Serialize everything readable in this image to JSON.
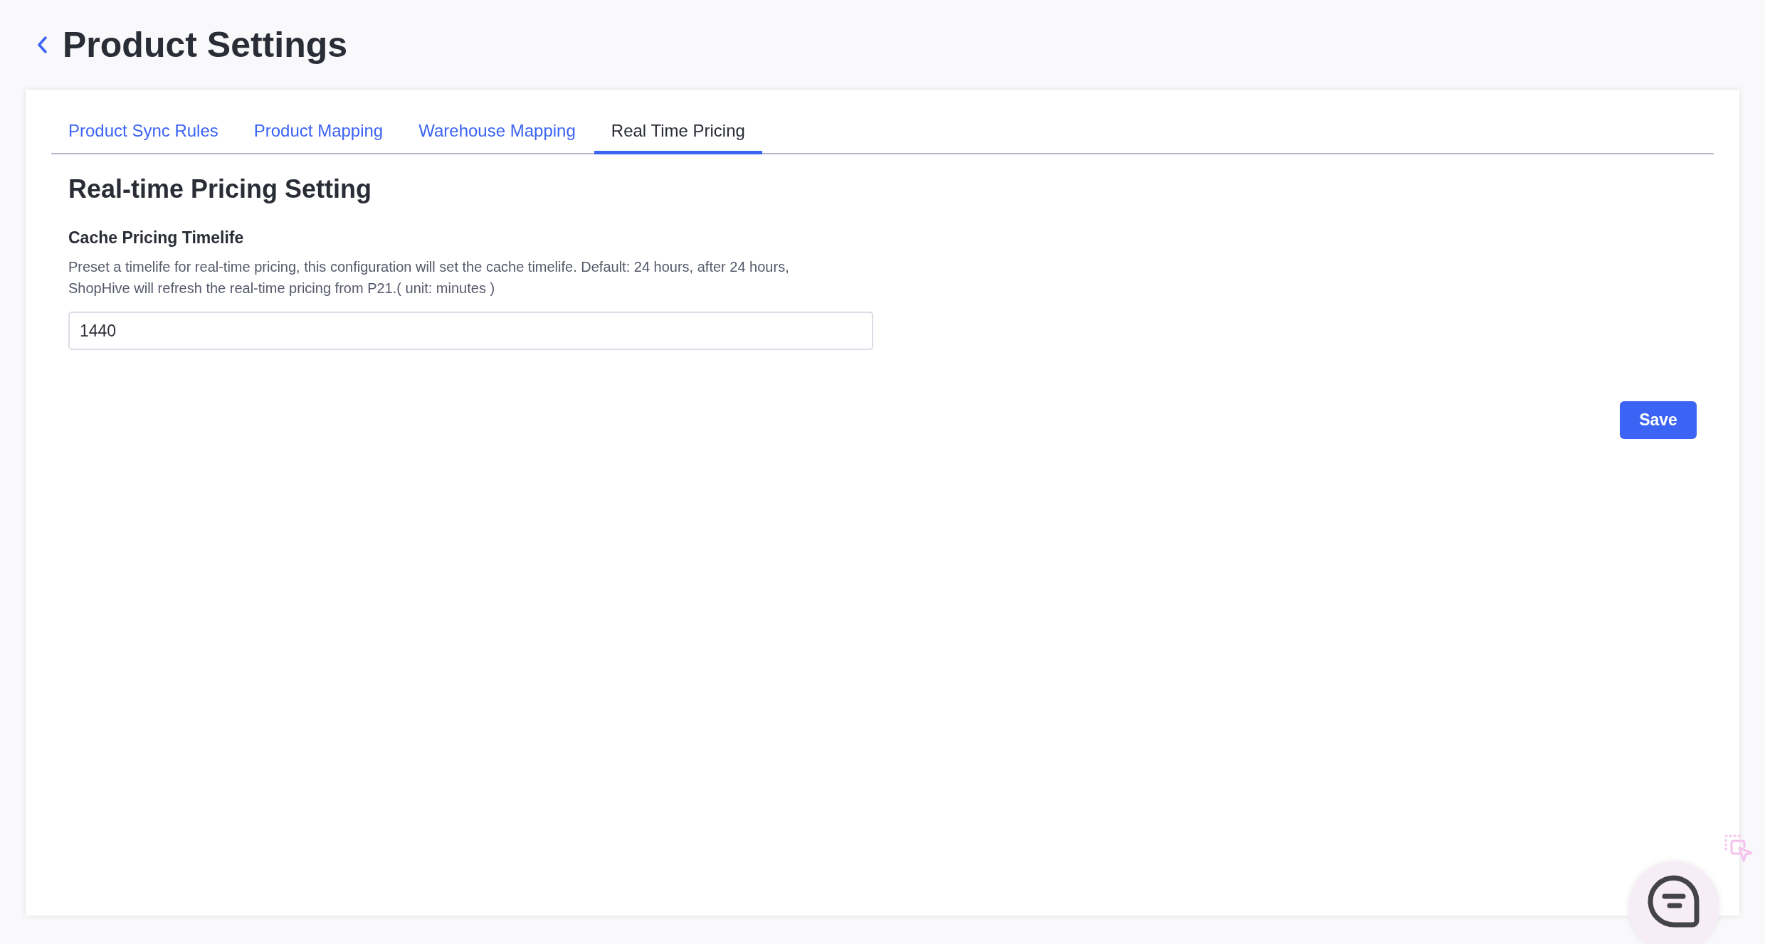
{
  "page": {
    "title": "Product Settings"
  },
  "tabs": [
    {
      "label": "Product Sync Rules",
      "selected": false
    },
    {
      "label": "Product Mapping",
      "selected": false
    },
    {
      "label": "Warehouse Mapping",
      "selected": false
    },
    {
      "label": "Real Time Pricing",
      "selected": true
    }
  ],
  "section": {
    "title": "Real-time Pricing Setting",
    "field_label": "Cache Pricing Timelife",
    "description": "Preset a timelife for real-time pricing, this configuration will set the cache timelife. Default: 24 hours, after 24 hours,\nShopHive will refresh the real-time pricing from P21.( unit: minutes )",
    "value": "1440"
  },
  "buttons": [
    "Save"
  ]
}
